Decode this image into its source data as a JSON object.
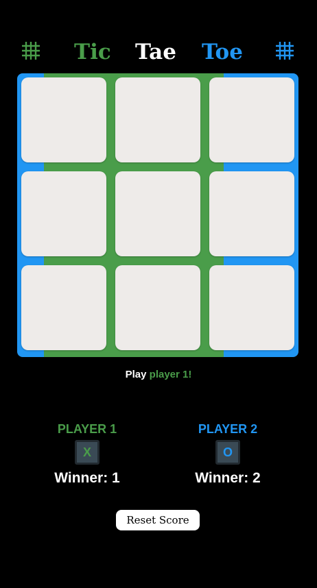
{
  "colors": {
    "player1": "#4a9d4a",
    "player2": "#2196f3",
    "title_middle": "#ffffff",
    "background": "#000000",
    "cell": "#eeebe9"
  },
  "header": {
    "words": [
      "Tic",
      "Tae",
      "Toe"
    ],
    "left_icon": "hash-grid-icon",
    "right_icon": "hash-grid-icon"
  },
  "board": {
    "cells": [
      "",
      "",
      "",
      "",
      "",
      "",
      "",
      "",
      ""
    ]
  },
  "status": {
    "prefix": "Play",
    "player": "player 1!"
  },
  "players": [
    {
      "name": "PLAYER 1",
      "symbol": "X",
      "wins_text": "Winner: 1"
    },
    {
      "name": "PLAYER 2",
      "symbol": "O",
      "wins_text": "Winner: 2"
    }
  ],
  "reset_label": "Reset Score"
}
